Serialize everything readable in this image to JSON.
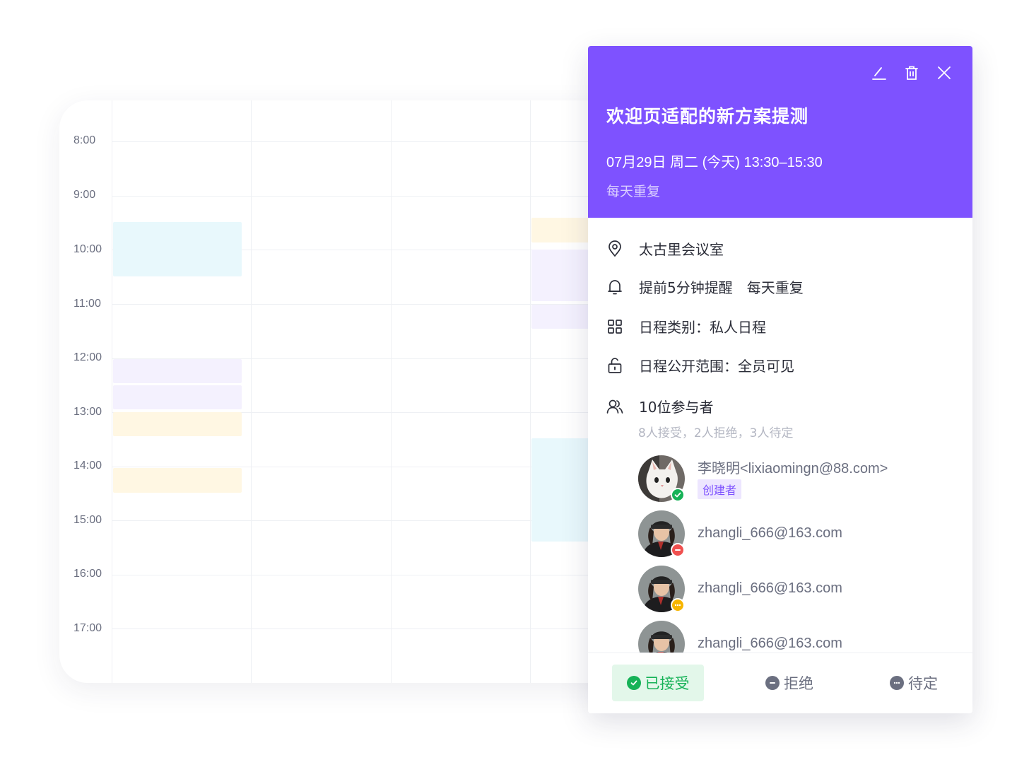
{
  "calendar": {
    "hours": [
      "8:00",
      "9:00",
      "10:00",
      "11:00",
      "12:00",
      "13:00",
      "14:00",
      "15:00",
      "16:00",
      "17:00"
    ]
  },
  "event": {
    "title": "欢迎页适配的新方案提测",
    "datetime": "07月29日 周二 (今天) 13:30–15:30",
    "repeat": "每天重复",
    "location": "太古里会议室",
    "reminder": "提前5分钟提醒",
    "reminder_repeat": "每天重复",
    "category": "日程类别：私人日程",
    "visibility": "日程公开范围：全员可见",
    "participants_count": "10位参与者",
    "participants_summary": "8人接受，2人拒绝，3人待定"
  },
  "attendees": [
    {
      "name": "李晓明<lixiaomingn@88.com>",
      "tag": "创建者",
      "status": "accepted",
      "avatar": "cat-avatar"
    },
    {
      "name": "zhangli_666@163.com",
      "status": "declined",
      "avatar": "person-avatar"
    },
    {
      "name": "zhangli_666@163.com",
      "status": "pending",
      "avatar": "person-avatar"
    },
    {
      "name": "zhangli_666@163.com",
      "status": "declined",
      "avatar": "person-avatar"
    }
  ],
  "footer": {
    "accept_label": "已接受",
    "decline_label": "拒绝",
    "pending_label": "待定"
  },
  "colors": {
    "header": "#7e52ff",
    "accepted": "#16b257",
    "declined": "#f0504f",
    "pending": "#f7b500",
    "event_cyan": "#e8f8fc",
    "event_purple": "#f4f1fe",
    "event_yellow": "#fff7e3"
  },
  "icons": [
    "edit-icon",
    "trash-icon",
    "close-icon",
    "location-pin-icon",
    "bell-icon",
    "category-grid-icon",
    "unlock-icon",
    "people-icon"
  ]
}
